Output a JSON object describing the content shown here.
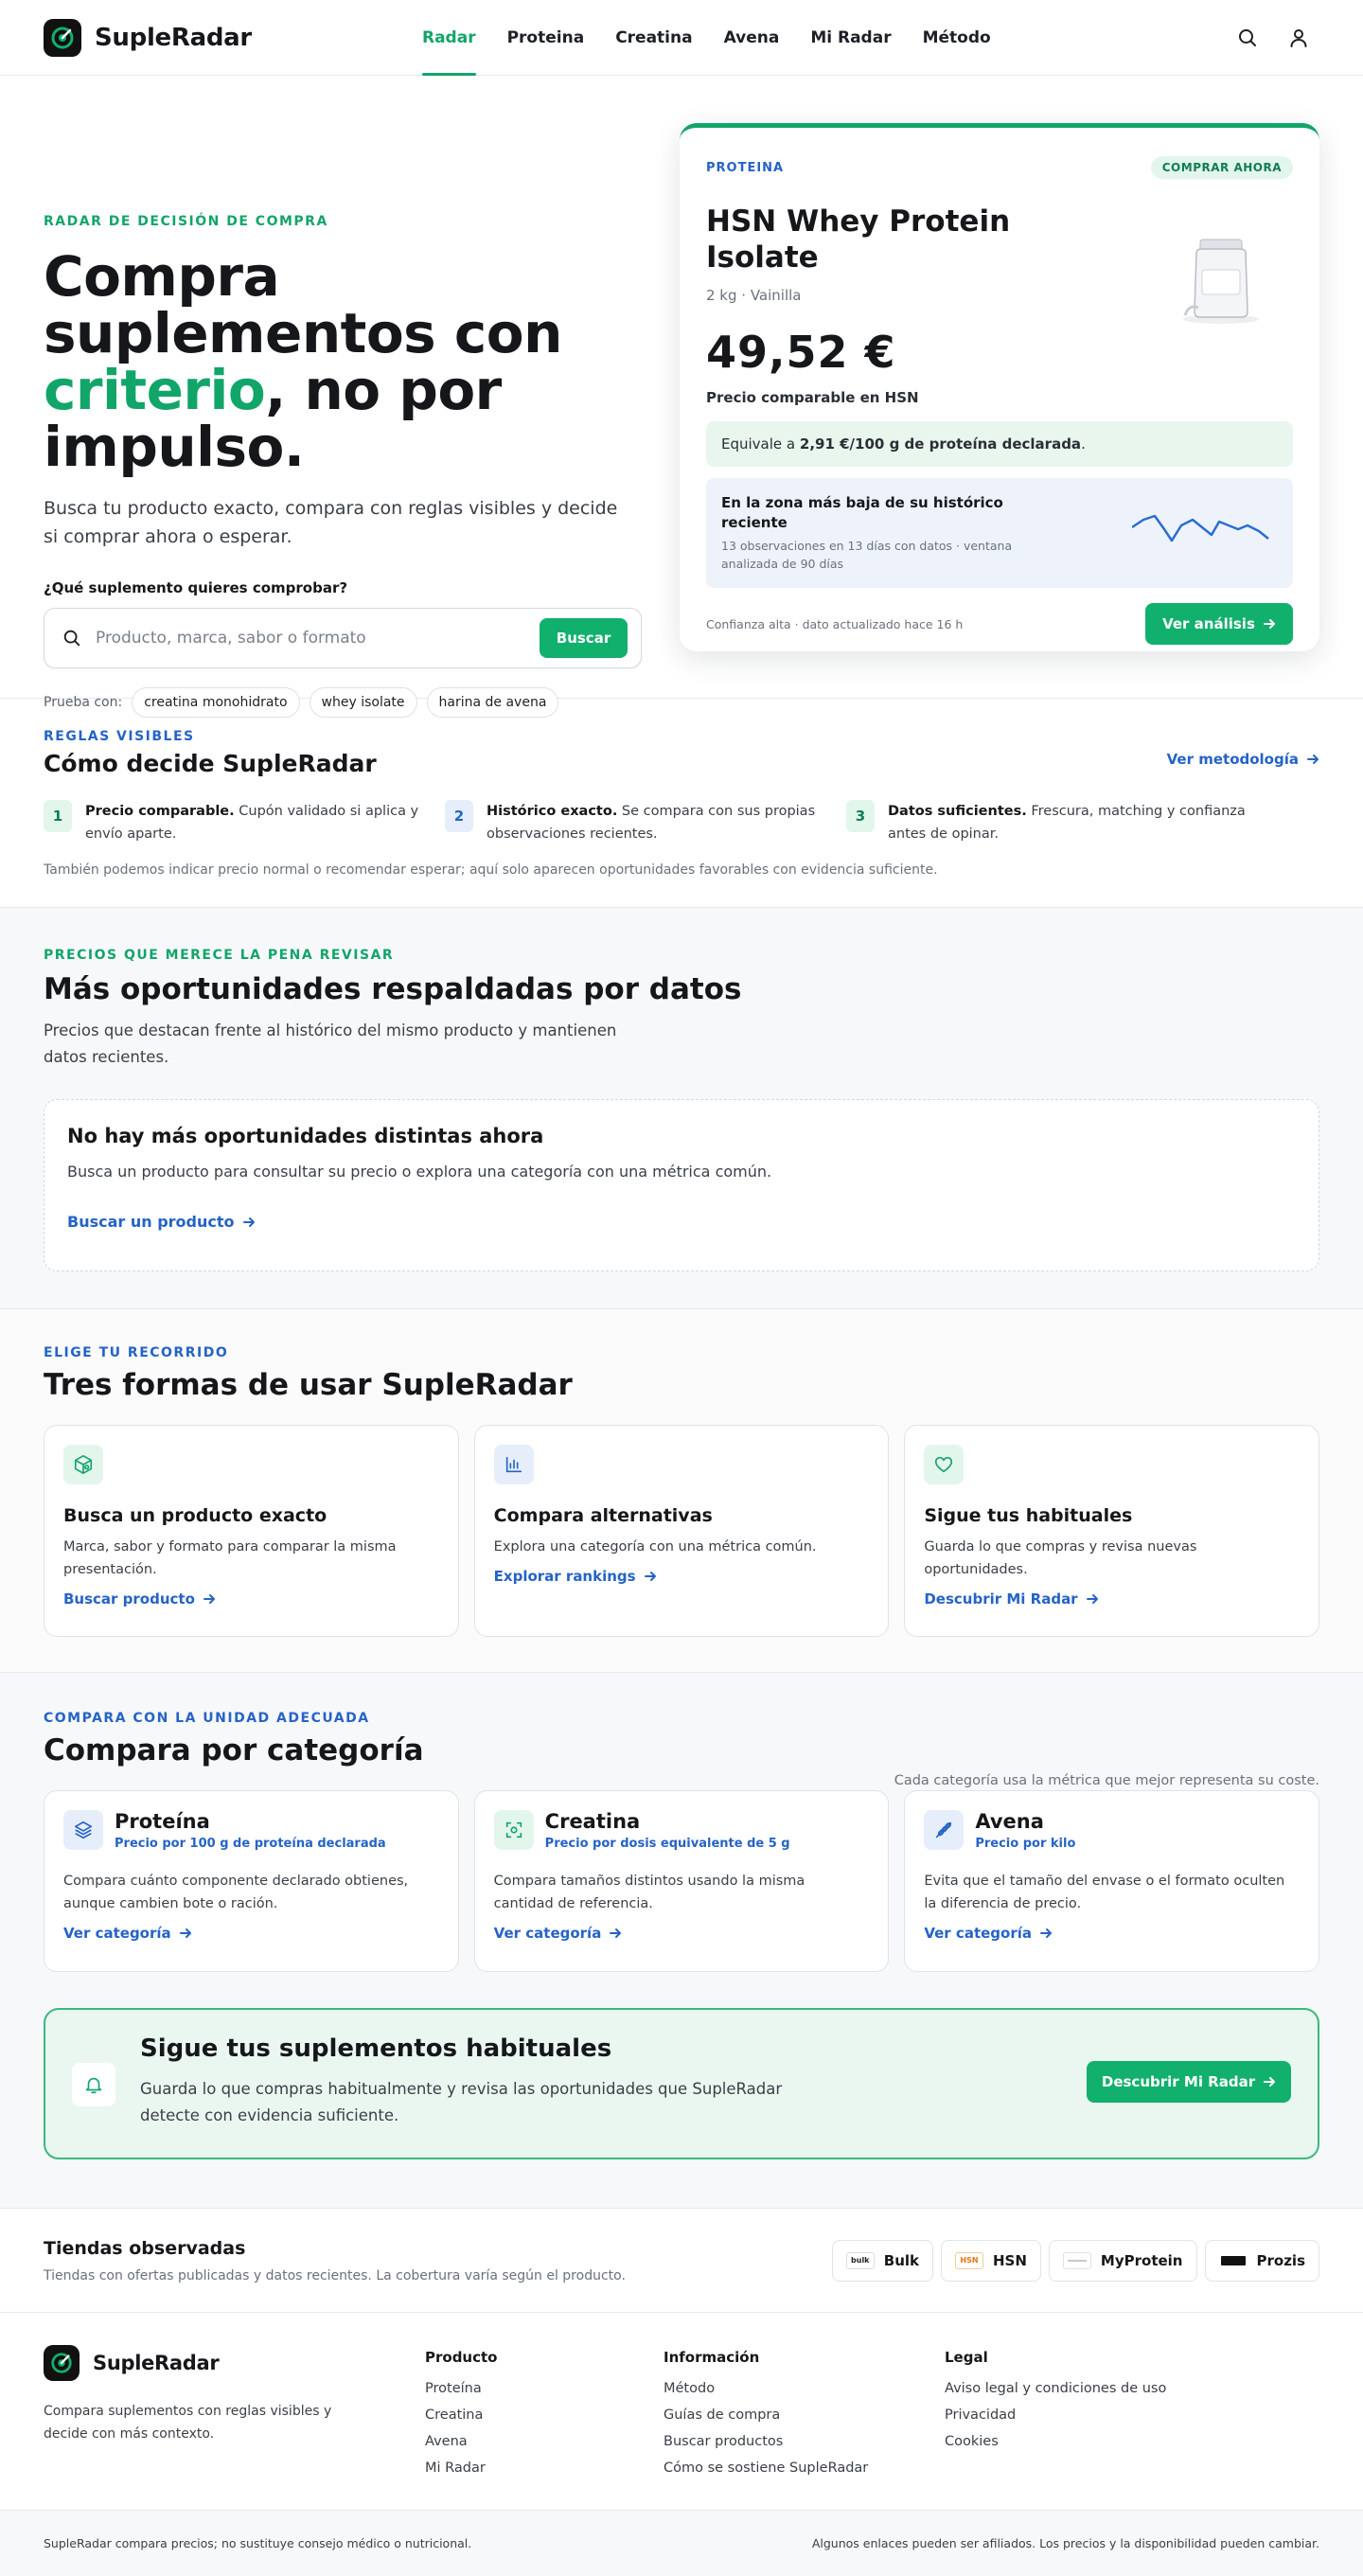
{
  "brand": {
    "name": "SupleRadar",
    "accent": "#12a56a",
    "blue": "#2563c7"
  },
  "nav": {
    "items": [
      {
        "label": "Radar"
      },
      {
        "label": "Proteina"
      },
      {
        "label": "Creatina"
      },
      {
        "label": "Avena"
      },
      {
        "label": "Mi Radar"
      },
      {
        "label": "Método"
      }
    ]
  },
  "hero": {
    "eyebrow": "RADAR DE DECISIÓN DE COMPRA",
    "title_l1": "Compra",
    "title_l2": "suplementos con",
    "title_hl": "criterio",
    "title_l3_rest": ", no por",
    "title_l4": "impulso.",
    "subtitle": "Busca tu producto exacto, compara con reglas visibles y decide si comprar ahora o esperar.",
    "search_label": "¿Qué suplemento quieres comprobar?",
    "search_placeholder": "Producto, marca, sabor o formato",
    "search_button": "Buscar",
    "try_label": "Prueba con:",
    "chips": [
      "creatina monohidrato",
      "whey isolate",
      "harina de avena"
    ]
  },
  "product": {
    "category": "PROTEINA",
    "badge": "COMPRAR AHORA",
    "name": "HSN Whey Protein Isolate",
    "variant": "2 kg · Vainilla",
    "price": "49,52 €",
    "price_label": "Precio comparable en HSN",
    "equiv_prefix": "Equivale a ",
    "equiv_value": "2,91 €/100 g de proteína declarada",
    "equiv_suffix": ".",
    "hist_title": "En la zona más baja de su histórico reciente",
    "hist_sub": "13 observaciones en 13 días con datos · ventana analizada de 90 días",
    "confidence": "Confianza alta · dato actualizado hace 16 h",
    "button": "Ver análisis",
    "spark_color": "#2a6dd1"
  },
  "rules": {
    "eyebrow": "REGLAS VISIBLES",
    "title": "Cómo decide SupleRadar",
    "link": "Ver metodología",
    "items": [
      {
        "num": "1",
        "bold": "Precio comparable.",
        "text": " Cupón validado si aplica y envío aparte."
      },
      {
        "num": "2",
        "bold": "Histórico exacto.",
        "text": " Se compara con sus propias observaciones recientes."
      },
      {
        "num": "3",
        "bold": "Datos suficientes.",
        "text": " Frescura, matching y confianza antes de opinar."
      }
    ],
    "note": "También podemos indicar precio normal o recomendar esperar; aquí solo aparecen oportunidades favorables con evidencia suficiente."
  },
  "opps": {
    "eyebrow": "PRECIOS QUE MERECE LA PENA REVISAR",
    "title": "Más oportunidades respaldadas por datos",
    "subtitle": "Precios que destacan frente al histórico del mismo producto y mantienen datos recientes.",
    "empty_title": "No hay más oportunidades distintas ahora",
    "empty_text": "Busca un producto para consultar su precio o explora una categoría con una métrica común.",
    "empty_link": "Buscar un producto"
  },
  "ways": {
    "eyebrow": "ELIGE TU RECORRIDO",
    "title": "Tres formas de usar SupleRadar",
    "cards": [
      {
        "title": "Busca un producto exacto",
        "text": "Marca, sabor y formato para comparar la misma presentación.",
        "link": "Buscar producto"
      },
      {
        "title": "Compara alternativas",
        "text": "Explora una categoría con una métrica común.",
        "link": "Explorar rankings"
      },
      {
        "title": "Sigue tus habituales",
        "text": "Guarda lo que compras y revisa nuevas oportunidades.",
        "link": "Descubrir Mi Radar"
      }
    ]
  },
  "cats": {
    "eyebrow": "COMPARA CON LA UNIDAD ADECUADA",
    "title": "Compara por categoría",
    "note": "Cada categoría usa la métrica que mejor representa su coste.",
    "cards": [
      {
        "title": "Proteína",
        "metric": "Precio por 100 g de proteína declarada",
        "text": "Compara cuánto componente declarado obtienes, aunque cambien bote o ración.",
        "link": "Ver categoría"
      },
      {
        "title": "Creatina",
        "metric": "Precio por dosis equivalente de 5 g",
        "text": "Compara tamaños distintos usando la misma cantidad de referencia.",
        "link": "Ver categoría"
      },
      {
        "title": "Avena",
        "metric": "Precio por kilo",
        "text": "Evita que el tamaño del envase o el formato oculten la diferencia de precio.",
        "link": "Ver categoría"
      }
    ],
    "follow_title": "Sigue tus suplementos habituales",
    "follow_text": "Guarda lo que compras habitualmente y revisa las oportunidades que SupleRadar detecte con evidencia suficiente.",
    "follow_button": "Descubrir Mi Radar"
  },
  "stores": {
    "title": "Tiendas observadas",
    "subtitle": "Tiendas con ofertas publicadas y datos recientes. La cobertura varía según el producto.",
    "items": [
      {
        "name": "Bulk",
        "logo": "bulk"
      },
      {
        "name": "HSN",
        "logo": "HSN"
      },
      {
        "name": "MyProtein",
        "logo": ""
      },
      {
        "name": "Prozis",
        "logo": ""
      }
    ]
  },
  "footer": {
    "desc": "Compara suplementos con reglas visibles y decide con más contexto.",
    "cols": [
      {
        "title": "Producto",
        "links": [
          "Proteína",
          "Creatina",
          "Avena",
          "Mi Radar"
        ]
      },
      {
        "title": "Información",
        "links": [
          "Método",
          "Guías de compra",
          "Buscar productos",
          "Cómo se sostiene SupleRadar"
        ]
      },
      {
        "title": "Legal",
        "links": [
          "Aviso legal y condiciones de uso",
          "Privacidad",
          "Cookies"
        ]
      }
    ],
    "bottom_left": "SupleRadar compara precios; no sustituye consejo médico o nutricional.",
    "bottom_right": "Algunos enlaces pueden ser afiliados. Los precios y la disponibilidad pueden cambiar."
  }
}
